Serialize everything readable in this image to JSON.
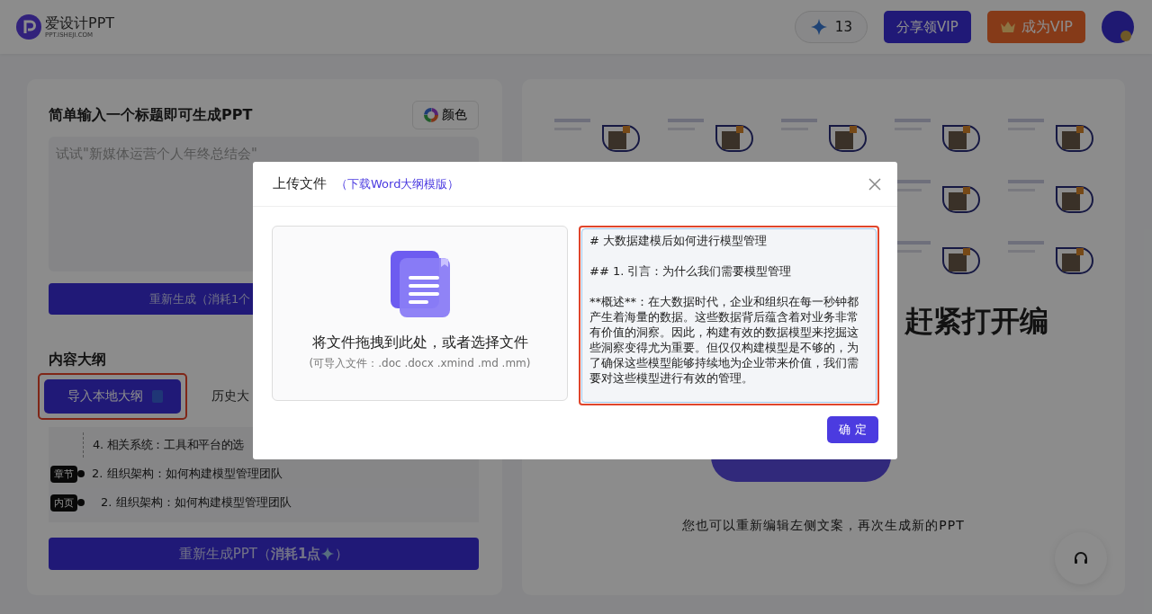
{
  "header": {
    "logo_name": "爱设计PPT",
    "logo_domain": "PPT.ISHEJI.COM",
    "points": "13",
    "share_button": "分享领VIP",
    "vip_button": "成为VIP"
  },
  "left_panel": {
    "title": "简单输入一个标题即可生成PPT",
    "color_button": "颜色",
    "topic_field": {
      "placeholder": "试试\"新媒体运营个人年终总结会\""
    },
    "regenerate_button": "重新生成（消耗1个",
    "outline_title": "内容大纲",
    "outline_tabs": [
      {
        "label": "导入本地大纲",
        "selected": true,
        "highlighted": true
      },
      {
        "label": "历史大",
        "selected": false,
        "highlighted": false
      }
    ],
    "outline_rows": [
      {
        "kind": "item",
        "text": "4. 相关系统：工具和平台的选"
      },
      {
        "kind": "chapter",
        "tag": "章节",
        "text": "2. 组织架构：如何构建模型管理团队"
      },
      {
        "kind": "page",
        "tag": "内页",
        "text": "2. 组织架构：如何构建模型管理团队"
      }
    ],
    "generate_button": {
      "text": "重新生成PPT（**消耗1点**",
      "suffix": "）"
    }
  },
  "right_panel": {
    "heading": "赶紧打开编",
    "note": "您也可以重新编辑左侧文案，再次生成新的PPT"
  },
  "modal": {
    "title": "上传文件",
    "template_link": "（下载Word大纲模版）",
    "drop_title": "将文件拖拽到此处，或者选择文件",
    "drop_hint": "(可导入文件：.doc .docx .xmind .md .mm)",
    "outline_text": {
      "highlighted": true,
      "value": "# 大数据建模后如何进行模型管理\n\n## 1. 引言：为什么我们需要模型管理\n\n**概述**：在大数据时代，企业和组织在每一秒钟都产生着海量的数据。这些数据背后蕴含着对业务非常有价值的洞察。因此，构建有效的数据模型来挖掘这些洞察变得尤为重要。但仅仅构建模型是不够的，为了确保这些模型能够持续地为企业带来价值，我们需要对这些模型进行有效的管理。"
    },
    "confirm_button": "确 定"
  }
}
